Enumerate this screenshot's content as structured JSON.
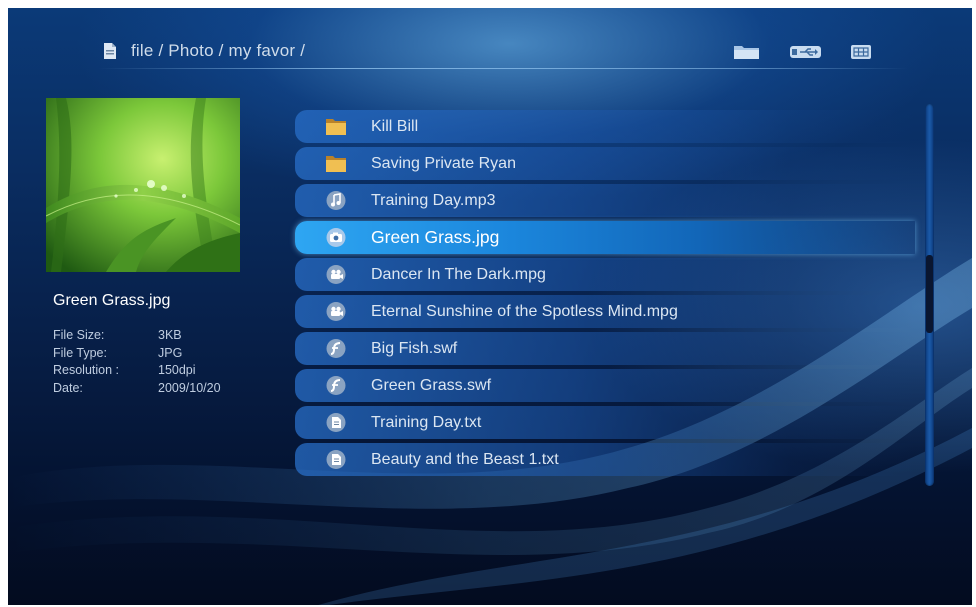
{
  "header": {
    "breadcrumb": "file / Photo / my favor /",
    "icons": [
      "document-icon",
      "folder-icon",
      "usb-icon",
      "grid-view-icon"
    ]
  },
  "preview": {
    "image": "green grass thumbnail",
    "name": "Green Grass.jpg",
    "details": [
      {
        "label": "File Size:",
        "value": "3KB"
      },
      {
        "label": "File Type:",
        "value": "JPG"
      },
      {
        "label": "Resolution :",
        "value": "150dpi"
      },
      {
        "label": "Date:",
        "value": "2009/10/20"
      }
    ]
  },
  "files": [
    {
      "label": "Kill Bill",
      "icon": "folder-icon"
    },
    {
      "label": "Saving Private Ryan",
      "icon": "folder-icon"
    },
    {
      "label": "Training Day.mp3",
      "icon": "music-icon"
    },
    {
      "label": "Green Grass.jpg",
      "icon": "camera-icon",
      "selected": true
    },
    {
      "label": "Dancer In The Dark.mpg",
      "icon": "video-icon"
    },
    {
      "label": "Eternal Sunshine of the Spotless Mind.mpg",
      "icon": "video-icon"
    },
    {
      "label": "Big Fish.swf",
      "icon": "flash-icon"
    },
    {
      "label": "Green Grass.swf",
      "icon": "flash-icon"
    },
    {
      "label": "Training Day.txt",
      "icon": "text-file-icon"
    },
    {
      "label": "Beauty and the Beast 1.txt",
      "icon": "text-file-icon"
    }
  ],
  "colors": {
    "background": "#0a2e63",
    "selection": "#1b86dc",
    "folder": "#e8b54a"
  }
}
